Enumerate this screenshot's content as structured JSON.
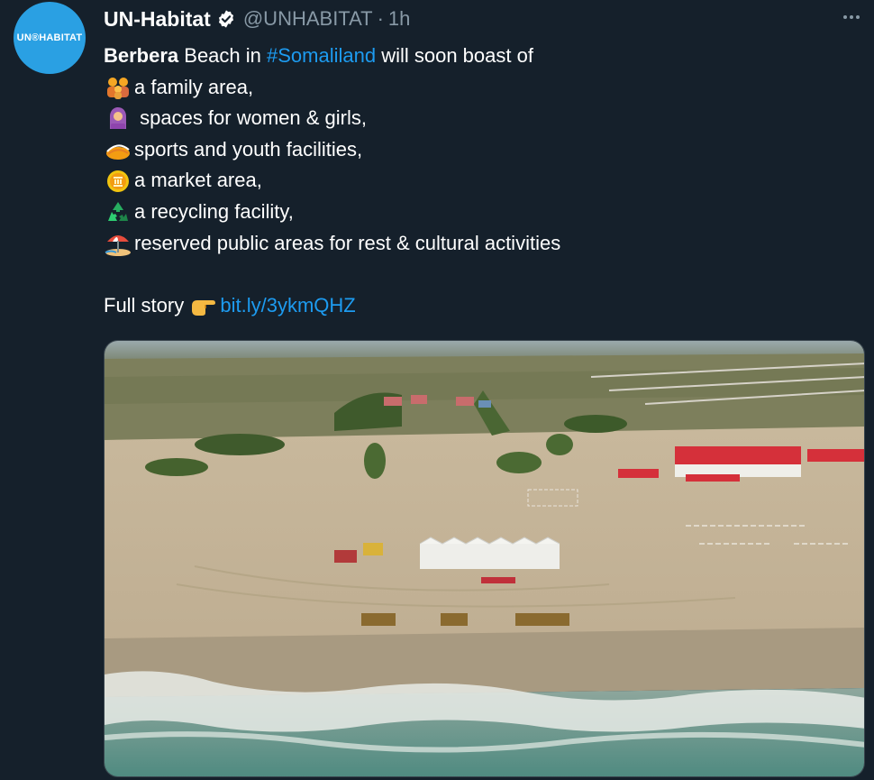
{
  "account": {
    "avatar_text": "UN®HABITAT",
    "name": "UN-Habitat",
    "handle": "@UNHABITAT",
    "separator": "·",
    "time": "1h"
  },
  "tweet": {
    "line1": {
      "bold": "Berbera",
      "text1": " Beach in ",
      "hashtag": "#Somaliland",
      "text2": " will soon boast of"
    },
    "items": [
      {
        "emoji": "family-emoji",
        "text": "a family area,"
      },
      {
        "emoji": "woman-headscarf-emoji",
        "text": " spaces for women & girls,"
      },
      {
        "emoji": "sports-emoji",
        "text": "sports and youth facilities,"
      },
      {
        "emoji": "coin-emoji",
        "text": "a market area,"
      },
      {
        "emoji": "recycling-emoji",
        "text": "a recycling facility,"
      },
      {
        "emoji": "beach-umbrella-emoji",
        "text": "reserved public areas for rest & cultural activities"
      }
    ],
    "full_story": "Full story ",
    "link": "bit.ly/3ykmQHZ"
  },
  "media": {
    "description": "aerial photo of Berbera beach construction site"
  }
}
